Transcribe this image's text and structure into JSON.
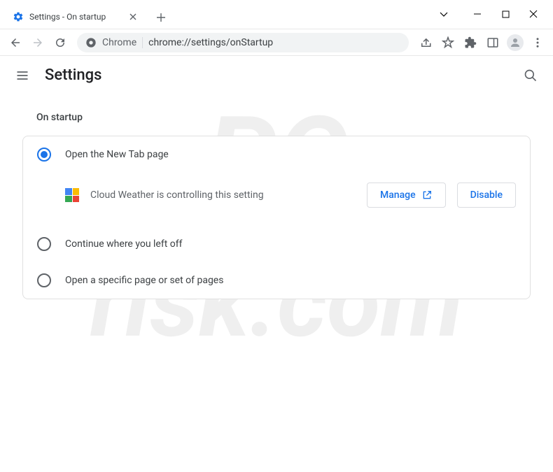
{
  "window": {
    "tab_title": "Settings - On startup"
  },
  "omnibox": {
    "scheme_label": "Chrome",
    "url": "chrome://settings/onStartup"
  },
  "settings": {
    "app_title": "Settings",
    "section_title": "On startup",
    "options": [
      {
        "label": "Open the New Tab page",
        "selected": true
      },
      {
        "label": "Continue where you left off",
        "selected": false
      },
      {
        "label": "Open a specific page or set of pages",
        "selected": false
      }
    ],
    "extension_notice": "Cloud Weather is controlling this setting",
    "manage_label": "Manage",
    "disable_label": "Disable"
  },
  "watermark": "PCrisk.com"
}
